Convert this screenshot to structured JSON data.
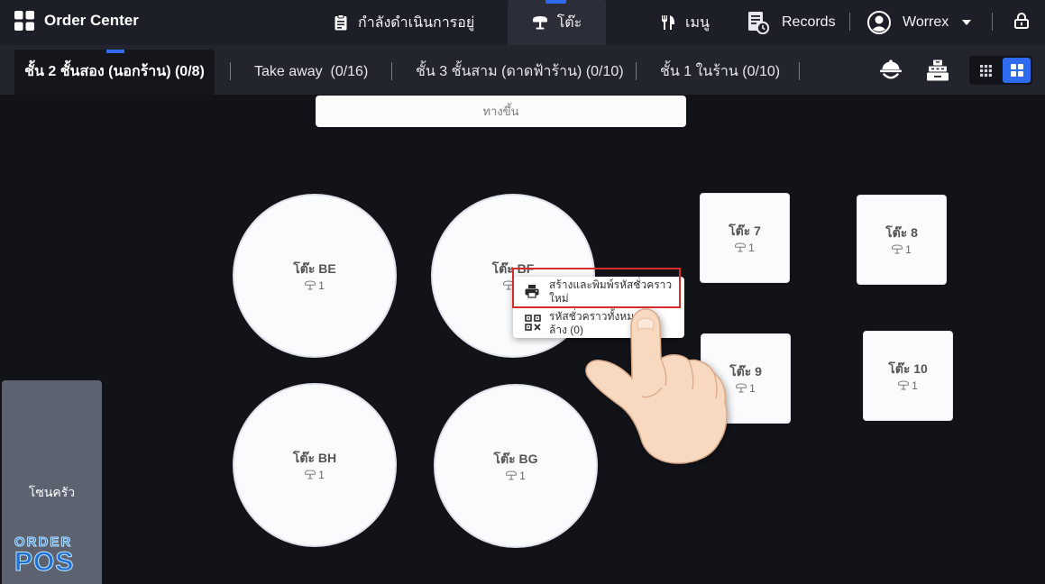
{
  "app": {
    "title": "Order Center",
    "icon": "app-grid-icon"
  },
  "nav": {
    "tabs": [
      {
        "label": "กำลังดำเนินการอยู่",
        "icon": "clipboard-icon",
        "active": false
      },
      {
        "label": "โต๊ะ",
        "icon": "table-icon",
        "active": true
      },
      {
        "label": "เมนู",
        "icon": "fork-knife-icon",
        "active": false
      },
      {
        "label": "Records",
        "icon": "records-icon",
        "active": false
      }
    ],
    "user": {
      "name": "Worrex",
      "icon": "avatar-icon"
    },
    "lock_icon": "lock-icon"
  },
  "zones": {
    "tabs": [
      {
        "label": "ชั้น 2 ชั้นสอง (นอกร้าน) (0/8)",
        "active": true
      },
      {
        "label": "Take away  (0/16)",
        "active": false
      },
      {
        "label": "ชั้น 3 ชั้นสาม (ดาดฟ้าร้าน) (0/10)",
        "active": false
      },
      {
        "label": "ชั้น 1 ในร้าน (0/10)",
        "active": false
      }
    ],
    "tools": [
      {
        "icon": "waiter-icon"
      },
      {
        "icon": "cash-register-icon"
      }
    ],
    "view_toggle": [
      {
        "icon": "grid-small-icon",
        "active": false
      },
      {
        "icon": "grid-large-icon",
        "active": true
      }
    ]
  },
  "floor": {
    "entrance_label": "ทางขึ้น",
    "seat_icon": "table-icon",
    "tables": [
      {
        "name": "โต๊ะ BE",
        "seats": 1
      },
      {
        "name": "โต๊ะ BF",
        "seats": 1
      },
      {
        "name": "โต๊ะ BH",
        "seats": 1
      },
      {
        "name": "โต๊ะ BG",
        "seats": 1
      },
      {
        "name": "โต๊ะ 7",
        "seats": 1
      },
      {
        "name": "โต๊ะ 8",
        "seats": 1
      },
      {
        "name": "โต๊ะ 9",
        "seats": 1
      },
      {
        "name": "โต๊ะ 10",
        "seats": 1
      }
    ]
  },
  "context_menu": {
    "items": [
      {
        "lines": [
          "สร้างและพิมพ์รหัสชั่วคราว",
          "ใหม่"
        ],
        "icon": "printer-icon",
        "highlighted": true
      },
      {
        "lines": [
          "รหัสชั่วคราวทั้งหมด",
          "ล้าง (0)"
        ],
        "icon": "qr-code-icon",
        "highlighted": false
      }
    ]
  },
  "side_panel": {
    "label": "โซนครัว"
  },
  "brand": {
    "logo_top": "ORDER",
    "logo_bottom": "POS"
  },
  "colors": {
    "background": "#121319",
    "header": "#1d1f28",
    "zonebar": "#22252e",
    "zone_active": "#14161c",
    "tab_active": "#2b2e39",
    "accent": "#2f6bef",
    "card": "#fafbfd",
    "highlight": "#d62c2c",
    "side_panel": "#5d6271",
    "logo": "#1f6fd8"
  }
}
